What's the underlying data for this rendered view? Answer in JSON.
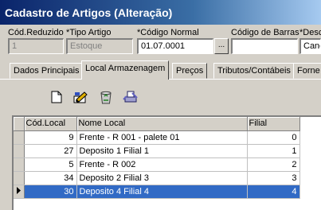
{
  "window": {
    "title": "Cadastro de Artigos (Alteração)"
  },
  "fields": {
    "cod_reduzido": {
      "label": "Cód.Reduzido",
      "value": "1"
    },
    "tipo_artigo": {
      "label": "*Tipo Artigo",
      "value": "Estoque"
    },
    "codigo_normal": {
      "label": "*Código Normal",
      "value": "01.07.0001"
    },
    "codigo_barras": {
      "label": "Código de Barras",
      "value": ""
    },
    "descricao": {
      "label": "*Desc",
      "value": "Cane"
    },
    "lookup_label": "..."
  },
  "tabs": [
    "Dados Principais",
    "Local Armazenagem",
    "Preços",
    "Tributos/Contábeis",
    "Forne"
  ],
  "active_tab": "Local Armazenagem",
  "toolbar": {
    "icons": [
      "new-document-icon",
      "edit-icon",
      "recycle-bin-icon",
      "print-icon"
    ]
  },
  "grid": {
    "columns": [
      "Cód.Local",
      "Nome Local",
      "Filial"
    ],
    "rows": [
      {
        "cod": "9",
        "nome": "Frente - R 001 - palete 01",
        "filial": "0"
      },
      {
        "cod": "27",
        "nome": "Deposito 1 Filial 1",
        "filial": "1"
      },
      {
        "cod": "5",
        "nome": "Frente - R 002",
        "filial": "2"
      },
      {
        "cod": "34",
        "nome": "Deposito 2 Filial 3",
        "filial": "3"
      },
      {
        "cod": "30",
        "nome": "Deposito 4 Filial 4",
        "filial": "4"
      }
    ],
    "selected_row": 4,
    "selection_color": "#316ac5"
  }
}
